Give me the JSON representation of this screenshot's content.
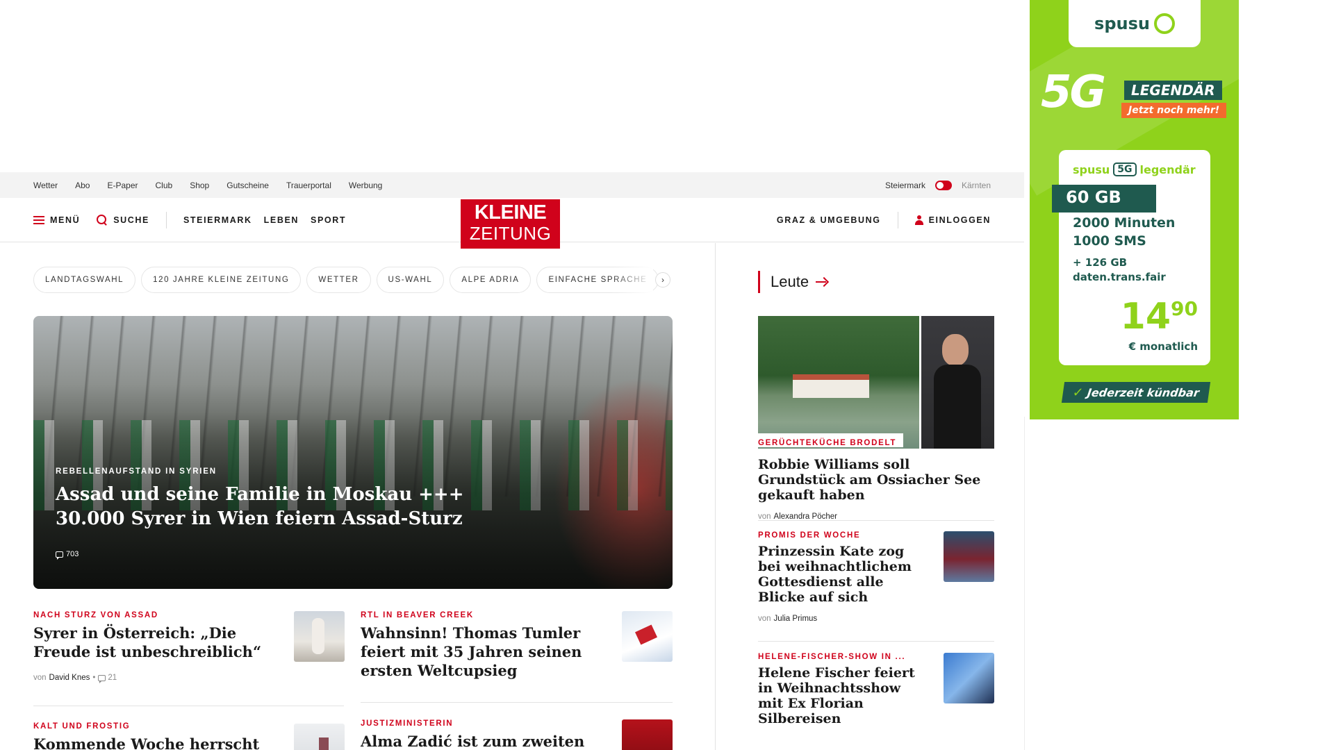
{
  "utility_links": [
    "Wetter",
    "Abo",
    "E-Paper",
    "Club",
    "Shop",
    "Gutscheine",
    "Trauerportal",
    "Werbung"
  ],
  "region_switch": {
    "active": "Steiermark",
    "inactive": "Kärnten"
  },
  "nav": {
    "menu": "MENÜ",
    "search": "SUCHE",
    "sections": [
      "STEIERMARK",
      "LEBEN",
      "SPORT"
    ],
    "region": "GRAZ & UMGEBUNG",
    "login": "EINLOGGEN"
  },
  "logo": {
    "line1": "KLEINE",
    "line2": "ZEITUNG"
  },
  "tags": [
    "LANDTAGSWAHL",
    "120 JAHRE KLEINE ZEITUNG",
    "WETTER",
    "US-WAHL",
    "ALPE ADRIA",
    "EINFACHE SPRACHE"
  ],
  "hero": {
    "overline": "REBELLENAUFSTAND IN SYRIEN",
    "headline": "Assad und seine Familie in Moskau +++ 30.000 Syrer in Wien feiern Assad-Sturz",
    "comments": "703"
  },
  "articles": [
    {
      "overline": "NACH STURZ VON ASSAD",
      "headline": "Syrer in Österreich: „Die Freude ist unbeschreiblich“",
      "by_prefix": "von",
      "author": "David Knes",
      "comments": "21"
    },
    {
      "overline": "RTL IN BEAVER CREEK",
      "headline": "Wahnsinn! Thomas Tumler feiert mit 35 Jahren seinen ersten Weltcupsieg"
    },
    {
      "overline": "KALT UND FROSTIG",
      "headline": "Kommende Woche herrscht"
    },
    {
      "overline": "JUSTIZMINISTERIN",
      "headline": "Alma Zadić ist zum zweiten"
    }
  ],
  "right": {
    "section_title": "Leute",
    "items": [
      {
        "overline": "GERÜCHTEKÜCHE BRODELT",
        "headline": "Robbie Williams soll Grundstück am Ossiacher See gekauft haben",
        "by_prefix": "von",
        "author": "Alexandra Pöcher"
      },
      {
        "overline": "PROMIS DER WOCHE",
        "headline": "Prinzessin Kate zog bei weihnachtlichem Gottesdienst alle Blicke auf sich",
        "by_prefix": "von",
        "author": "Julia Primus"
      },
      {
        "overline": "HELENE-FISCHER-SHOW IN ...",
        "headline": "Helene Fischer feiert in Weihnachtsshow mit Ex Florian Silbereisen"
      }
    ]
  },
  "ad": {
    "brand": "spusu",
    "big": "5G",
    "tagline": "LEGENDÄR",
    "cta": "Jetzt noch mehr!",
    "card_brand_left": "spusu",
    "card_brand_5g": "5G",
    "card_brand_right": "legendär",
    "data": "60 GB",
    "minutes": "2000 Minuten",
    "sms": "1000 SMS",
    "extra_gb": "+ 126 GB",
    "extra_note": "daten.trans.fair",
    "price_main": "14",
    "price_cents": "90",
    "price_unit": "€ monatlich",
    "cancel": "Jederzeit kündbar"
  },
  "colors": {
    "accent": "#d0021b",
    "ad_green": "#8fd21b",
    "ad_dark": "#1f5a4f"
  }
}
